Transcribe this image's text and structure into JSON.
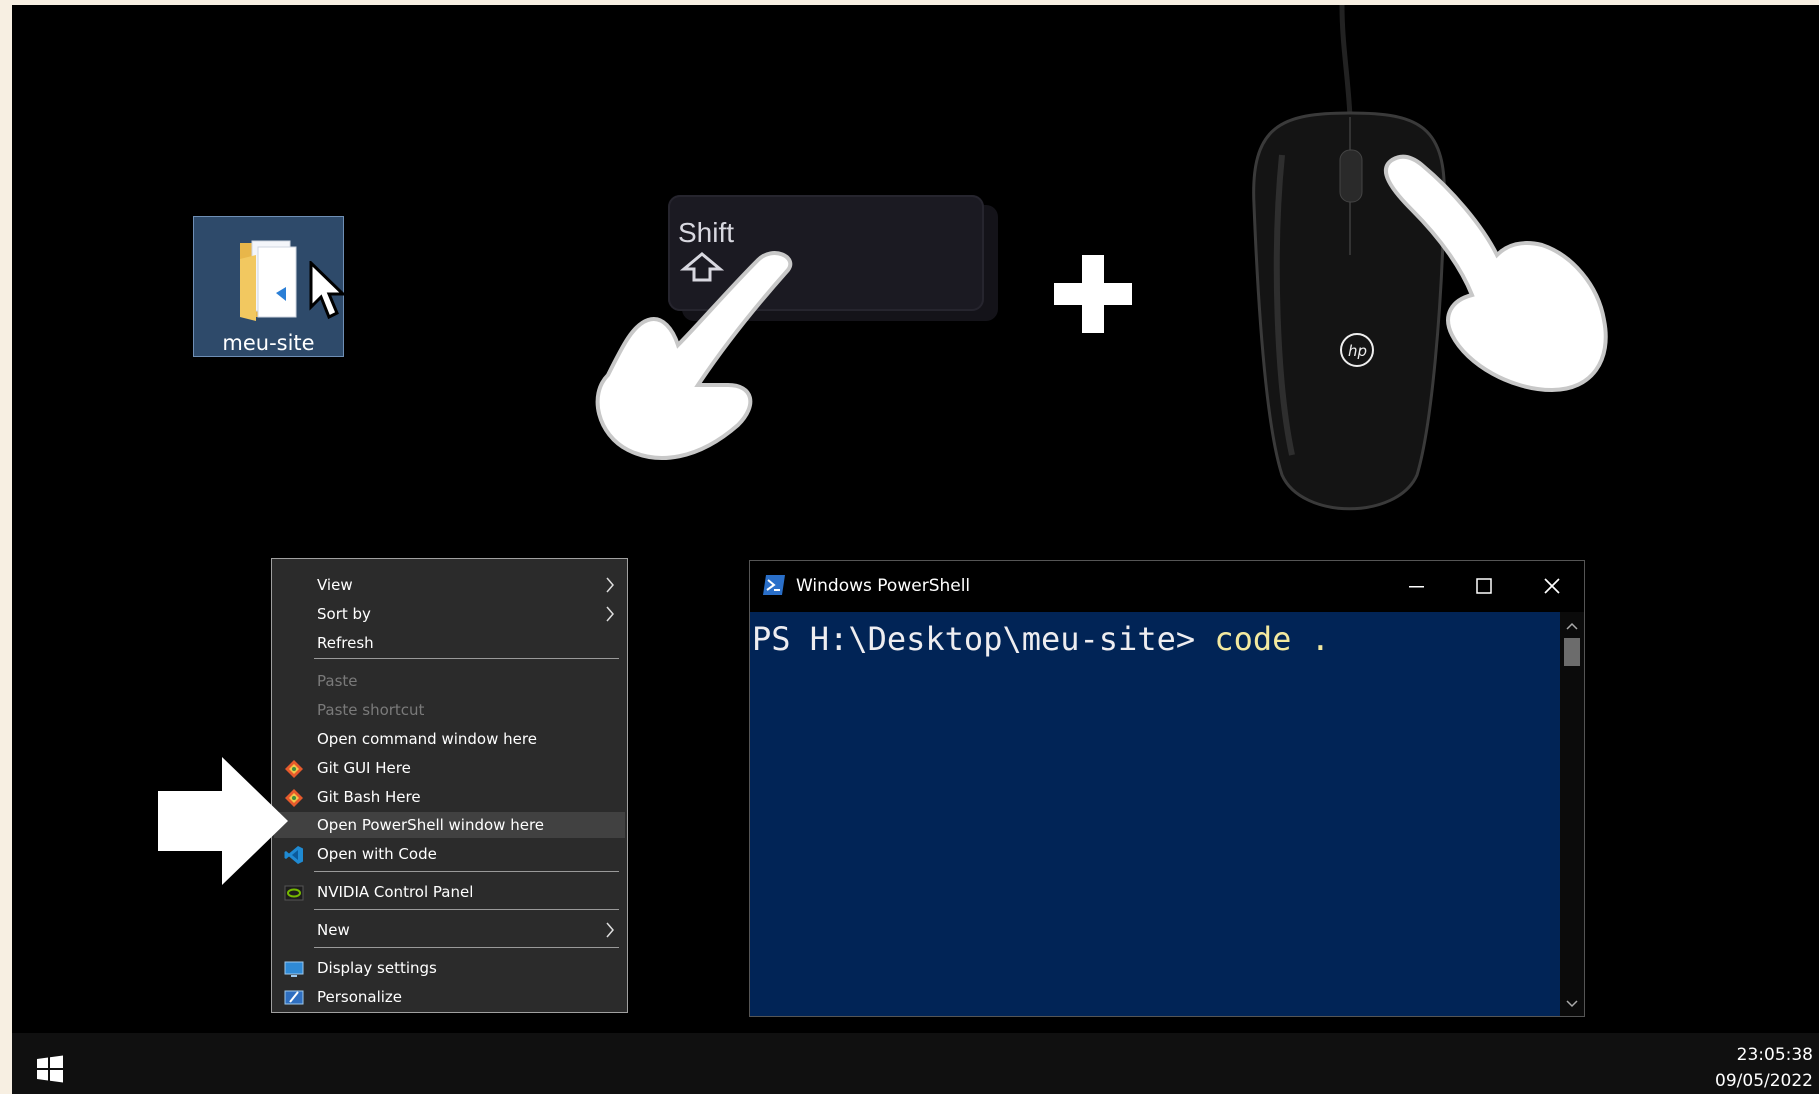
{
  "desktop_icon": {
    "label": "meu-site"
  },
  "shift_key": {
    "label": "Shift"
  },
  "context_menu": {
    "items": [
      {
        "label": "View",
        "submenu": true
      },
      {
        "label": "Sort by",
        "submenu": true
      },
      {
        "label": "Refresh"
      },
      {
        "label": "Paste",
        "disabled": true
      },
      {
        "label": "Paste shortcut",
        "disabled": true
      },
      {
        "label": "Open command window here"
      },
      {
        "label": "Git GUI Here",
        "icon": "git-icon"
      },
      {
        "label": "Git Bash Here",
        "icon": "git-icon"
      },
      {
        "label": "Open PowerShell window here",
        "highlighted": true
      },
      {
        "label": "Open with Code",
        "icon": "vscode-icon"
      },
      {
        "label": "NVIDIA Control Panel",
        "icon": "nvidia-icon"
      },
      {
        "label": "New",
        "submenu": true
      },
      {
        "label": "Display settings",
        "icon": "display-icon"
      },
      {
        "label": "Personalize",
        "icon": "personalize-icon"
      }
    ]
  },
  "powershell": {
    "title": "Windows PowerShell",
    "prompt": "PS H:\\Desktop\\meu-site> ",
    "command": "code ."
  },
  "taskbar": {
    "time": "23:05:38",
    "date": "09/05/2022"
  },
  "colors": {
    "ps_background": "#012456",
    "menu_background": "#2b2b2b",
    "highlight": "#414141"
  }
}
